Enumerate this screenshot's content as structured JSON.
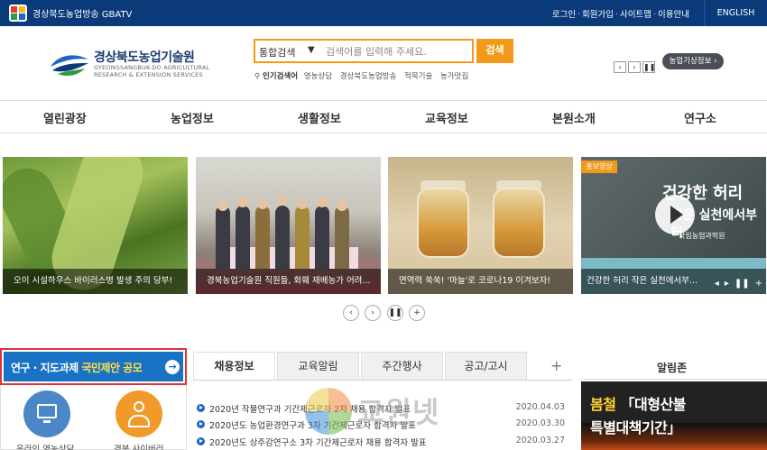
{
  "topbar": {
    "brand": "경상북도농업방송 GBATV",
    "links": [
      "로그인",
      "회원가입",
      "사이트맵",
      "이용안내"
    ],
    "english": "ENGLISH"
  },
  "header": {
    "org_name": "경상북도농업기술원",
    "org_sub1": "GYEONGSANGBUK-DO AGRICULTURAL",
    "org_sub2": "RESEARCH & EXTENSION SERVICES",
    "weather_button": "농업기상정보"
  },
  "search": {
    "category": "통합검색",
    "placeholder": "검색어를 입력해 주세요.",
    "button": "검색",
    "popular_label": "인기검색어",
    "popular_terms": [
      "영농상담",
      "경상북도농업방송",
      "적목기술",
      "농가맛집"
    ]
  },
  "nav": {
    "items": [
      "열린광장",
      "농업정보",
      "생활정보",
      "교육정보",
      "본원소개",
      "연구소"
    ]
  },
  "slides": [
    {
      "caption": "오이 시설하우스 바이러스병 발생 주의 당부!"
    },
    {
      "caption": "경북농업기술원 직원들, 화훼 재배농가 어려..."
    },
    {
      "caption": "면역력 쑥쑥! '마늘'로 코로나19 이겨보자!"
    },
    {
      "caption": "건강한 허리 작은 실천에서부...",
      "tag": "홍보영상",
      "overlay_title1": "건강한 허리",
      "overlay_title2": "작은 실천에서부터",
      "overlay_title3": "국립농업과학원"
    }
  ],
  "proposal": {
    "text_plain": "연구 · 지도과제 ",
    "text_highlight": "국민제안 공모"
  },
  "quick_links": [
    {
      "label": "온라인 영농상담",
      "icon": "monitor-icon"
    },
    {
      "label": "경북 사이버러",
      "icon": "user-icon"
    }
  ],
  "tabs": {
    "items": [
      "채용정보",
      "교육알림",
      "주간행사",
      "공고/고시"
    ],
    "active": 0,
    "plus": "+"
  },
  "news": [
    {
      "title": "2020년 작물연구과 기간제근로자 2차 채용 합격자 발표",
      "date": "2020.04.03"
    },
    {
      "title": "2020년도 농업환경연구과 3차 기간제근로자 합격자 발표",
      "date": "2020.03.30"
    },
    {
      "title": "2020년도 상주감연구소 3차 기간제근로자 채용 합격자 발표",
      "date": "2020.03.27"
    }
  ],
  "watermark": "교원넷",
  "notice": {
    "title": "알림존",
    "banner_line1_a": "봄철 ",
    "banner_line1_b": "「대형산불",
    "banner_line2": "특별대책기간」"
  },
  "colors": {
    "topbar": "#0b3a7a",
    "accent_orange": "#f39a1b",
    "proposal_blue": "#1a72c4",
    "proposal_border": "#dd3333"
  }
}
